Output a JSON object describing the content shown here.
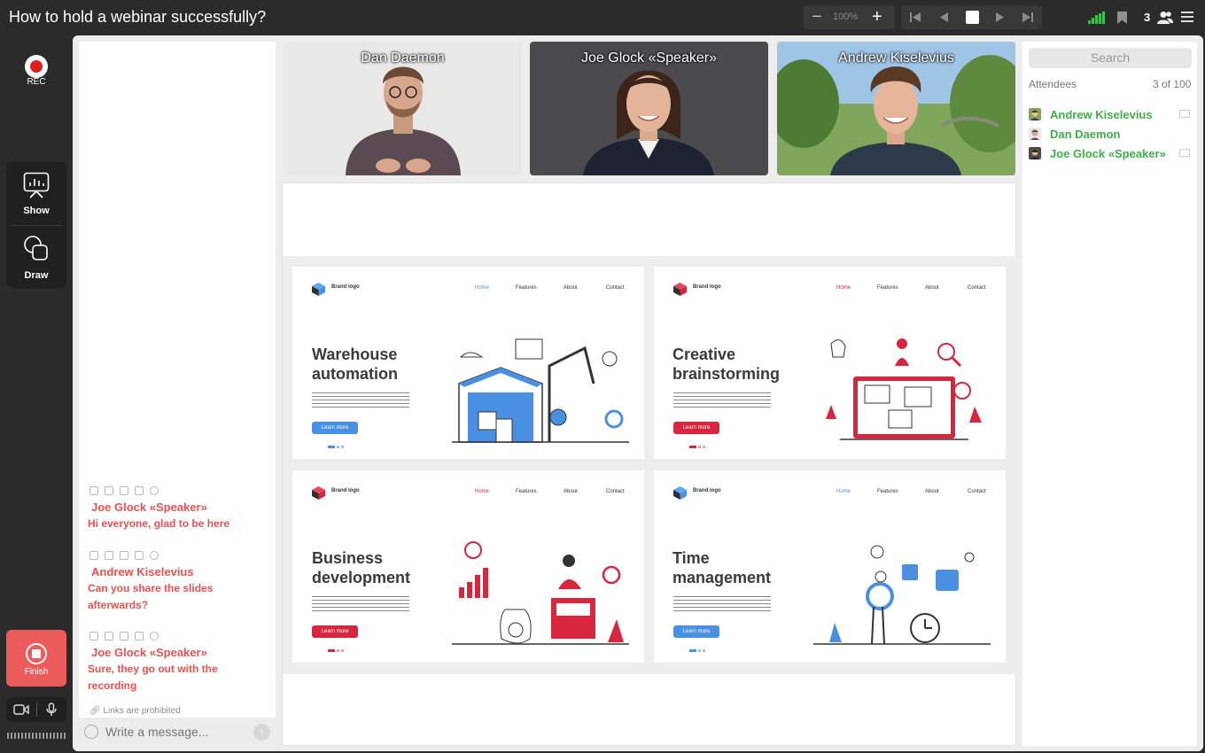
{
  "header": {
    "title": "How to hold a webinar successfully?",
    "zoom_minus_icon": "minus-icon",
    "zoom_level": "100%",
    "zoom_plus_icon": "plus-icon",
    "participants_count": "3"
  },
  "left_toolbar": {
    "rec_label": "REC",
    "show_label": "Show",
    "draw_label": "Draw",
    "finish_label": "Finish"
  },
  "participants": [
    {
      "name": "Dan Daemon"
    },
    {
      "name": "Joe Glock «Speaker»"
    },
    {
      "name": "Andrew Kiselevius"
    }
  ],
  "chat": {
    "messages": [
      {
        "author": "Joe Glock «Speaker»",
        "text": "Hi everyone, glad to be here"
      },
      {
        "author": "Andrew Kiselevius",
        "text": "Can you share the slides afterwards?"
      },
      {
        "author": "Joe Glock «Speaker»",
        "text": "Sure, they go out with the recording"
      }
    ],
    "links_note": "Links are prohibited",
    "input_placeholder": "Write a message..."
  },
  "slide": {
    "panels": [
      {
        "brand": "Brand logo",
        "nav": [
          "Home",
          "Features",
          "About",
          "Contact"
        ],
        "title_line1": "Warehouse",
        "title_line2": "automation",
        "button": "Learn more",
        "accent": "#4a90e2"
      },
      {
        "brand": "Brand logo",
        "nav": [
          "Home",
          "Features",
          "About",
          "Contact"
        ],
        "title_line1": "Creative",
        "title_line2": "brainstorming",
        "button": "Learn more",
        "accent": "#d9263f"
      },
      {
        "brand": "Brand logo",
        "nav": [
          "Home",
          "Features",
          "About",
          "Contact"
        ],
        "title_line1": "Business",
        "title_line2": "development",
        "button": "Learn more",
        "accent": "#d9263f"
      },
      {
        "brand": "Brand logo",
        "nav": [
          "Home",
          "Features",
          "About",
          "Contact"
        ],
        "title_line1": "Time",
        "title_line2": "management",
        "button": "Learn more",
        "accent": "#4a90e2"
      }
    ]
  },
  "attendees": {
    "search_placeholder": "Search",
    "label": "Attendees",
    "count": "3 of 100",
    "list": [
      {
        "name": "Andrew Kiselevius"
      },
      {
        "name": "Dan Daemon"
      },
      {
        "name": "Joe Glock «Speaker»"
      }
    ]
  },
  "colors": {
    "accent_green": "#3fae4a",
    "chat_red": "#ec5050",
    "finish_red": "#ec5b5b",
    "rec_red": "#e01f1f"
  }
}
